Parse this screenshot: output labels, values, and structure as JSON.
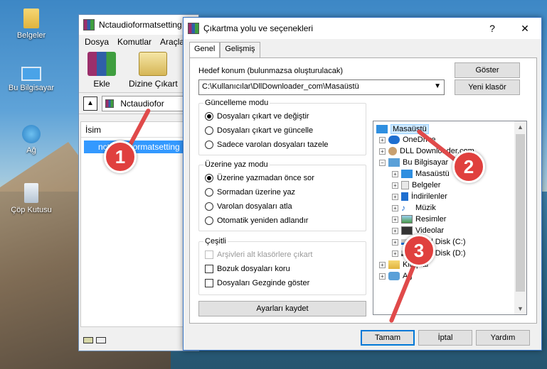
{
  "desktop": {
    "icons": [
      {
        "label": "Belgeler"
      },
      {
        "label": "Bu Bilgisayar"
      },
      {
        "label": "Ağ"
      },
      {
        "label": "Çöp Kutusu"
      }
    ]
  },
  "winrar": {
    "title": "Nctaudioformatsetting",
    "menu": [
      "Dosya",
      "Komutlar",
      "Araçla"
    ],
    "toolbar": {
      "add": "Ekle",
      "extract": "Dizine Çıkart"
    },
    "path": "Nctaudiofor",
    "column_name": "İsim",
    "file_row": "nctaudioformatsetting"
  },
  "dialog": {
    "title": "Çıkartma yolu ve seçenekleri",
    "help": "?",
    "close": "✕",
    "tabs": [
      "Genel",
      "Gelişmiş"
    ],
    "dest_label": "Hedef konum (bulunmazsa oluşturulacak)",
    "dest_value": "C:\\Kullanıcılar\\DllDownloader_com\\Masaüstü",
    "show_btn": "Göster",
    "new_folder_btn": "Yeni klasör",
    "update_mode": {
      "title": "Güncelleme modu",
      "options": [
        "Dosyaları çıkart ve değiştir",
        "Dosyaları çıkart ve güncelle",
        "Sadece varolan dosyaları tazele"
      ],
      "selected": 0
    },
    "overwrite_mode": {
      "title": "Üzerine yaz modu",
      "options": [
        "Üzerine yazmadan önce sor",
        "Sormadan üzerine yaz",
        "Varolan dosyaları atla",
        "Otomatik yeniden adlandır"
      ],
      "selected": 0
    },
    "misc": {
      "title": "Çeşitli",
      "options": [
        "Arşivleri alt klasörlere çıkart",
        "Bozuk dosyaları koru",
        "Dosyaları Gezginde göster"
      ]
    },
    "save_settings": "Ayarları kaydet",
    "tree": [
      {
        "label": "Masaüstü"
      },
      {
        "label": "OneDrive"
      },
      {
        "label": "DLL Downloader.com"
      },
      {
        "label": "Bu Bilgisayar"
      },
      {
        "label": "Masaüstü"
      },
      {
        "label": "Belgeler"
      },
      {
        "label": "İndirilenler"
      },
      {
        "label": "Müzik"
      },
      {
        "label": "Resimler"
      },
      {
        "label": "Videolar"
      },
      {
        "label": "Yerel Disk (C:)"
      },
      {
        "label": "Yerel Disk (D:)"
      },
      {
        "label": "Kitaplar"
      },
      {
        "label": "Ağ"
      }
    ],
    "ok": "Tamam",
    "cancel": "İptal",
    "help_btn": "Yardım"
  },
  "annotations": {
    "step1": "1",
    "step2": "2",
    "step3": "3",
    "color": "#e0403e"
  }
}
